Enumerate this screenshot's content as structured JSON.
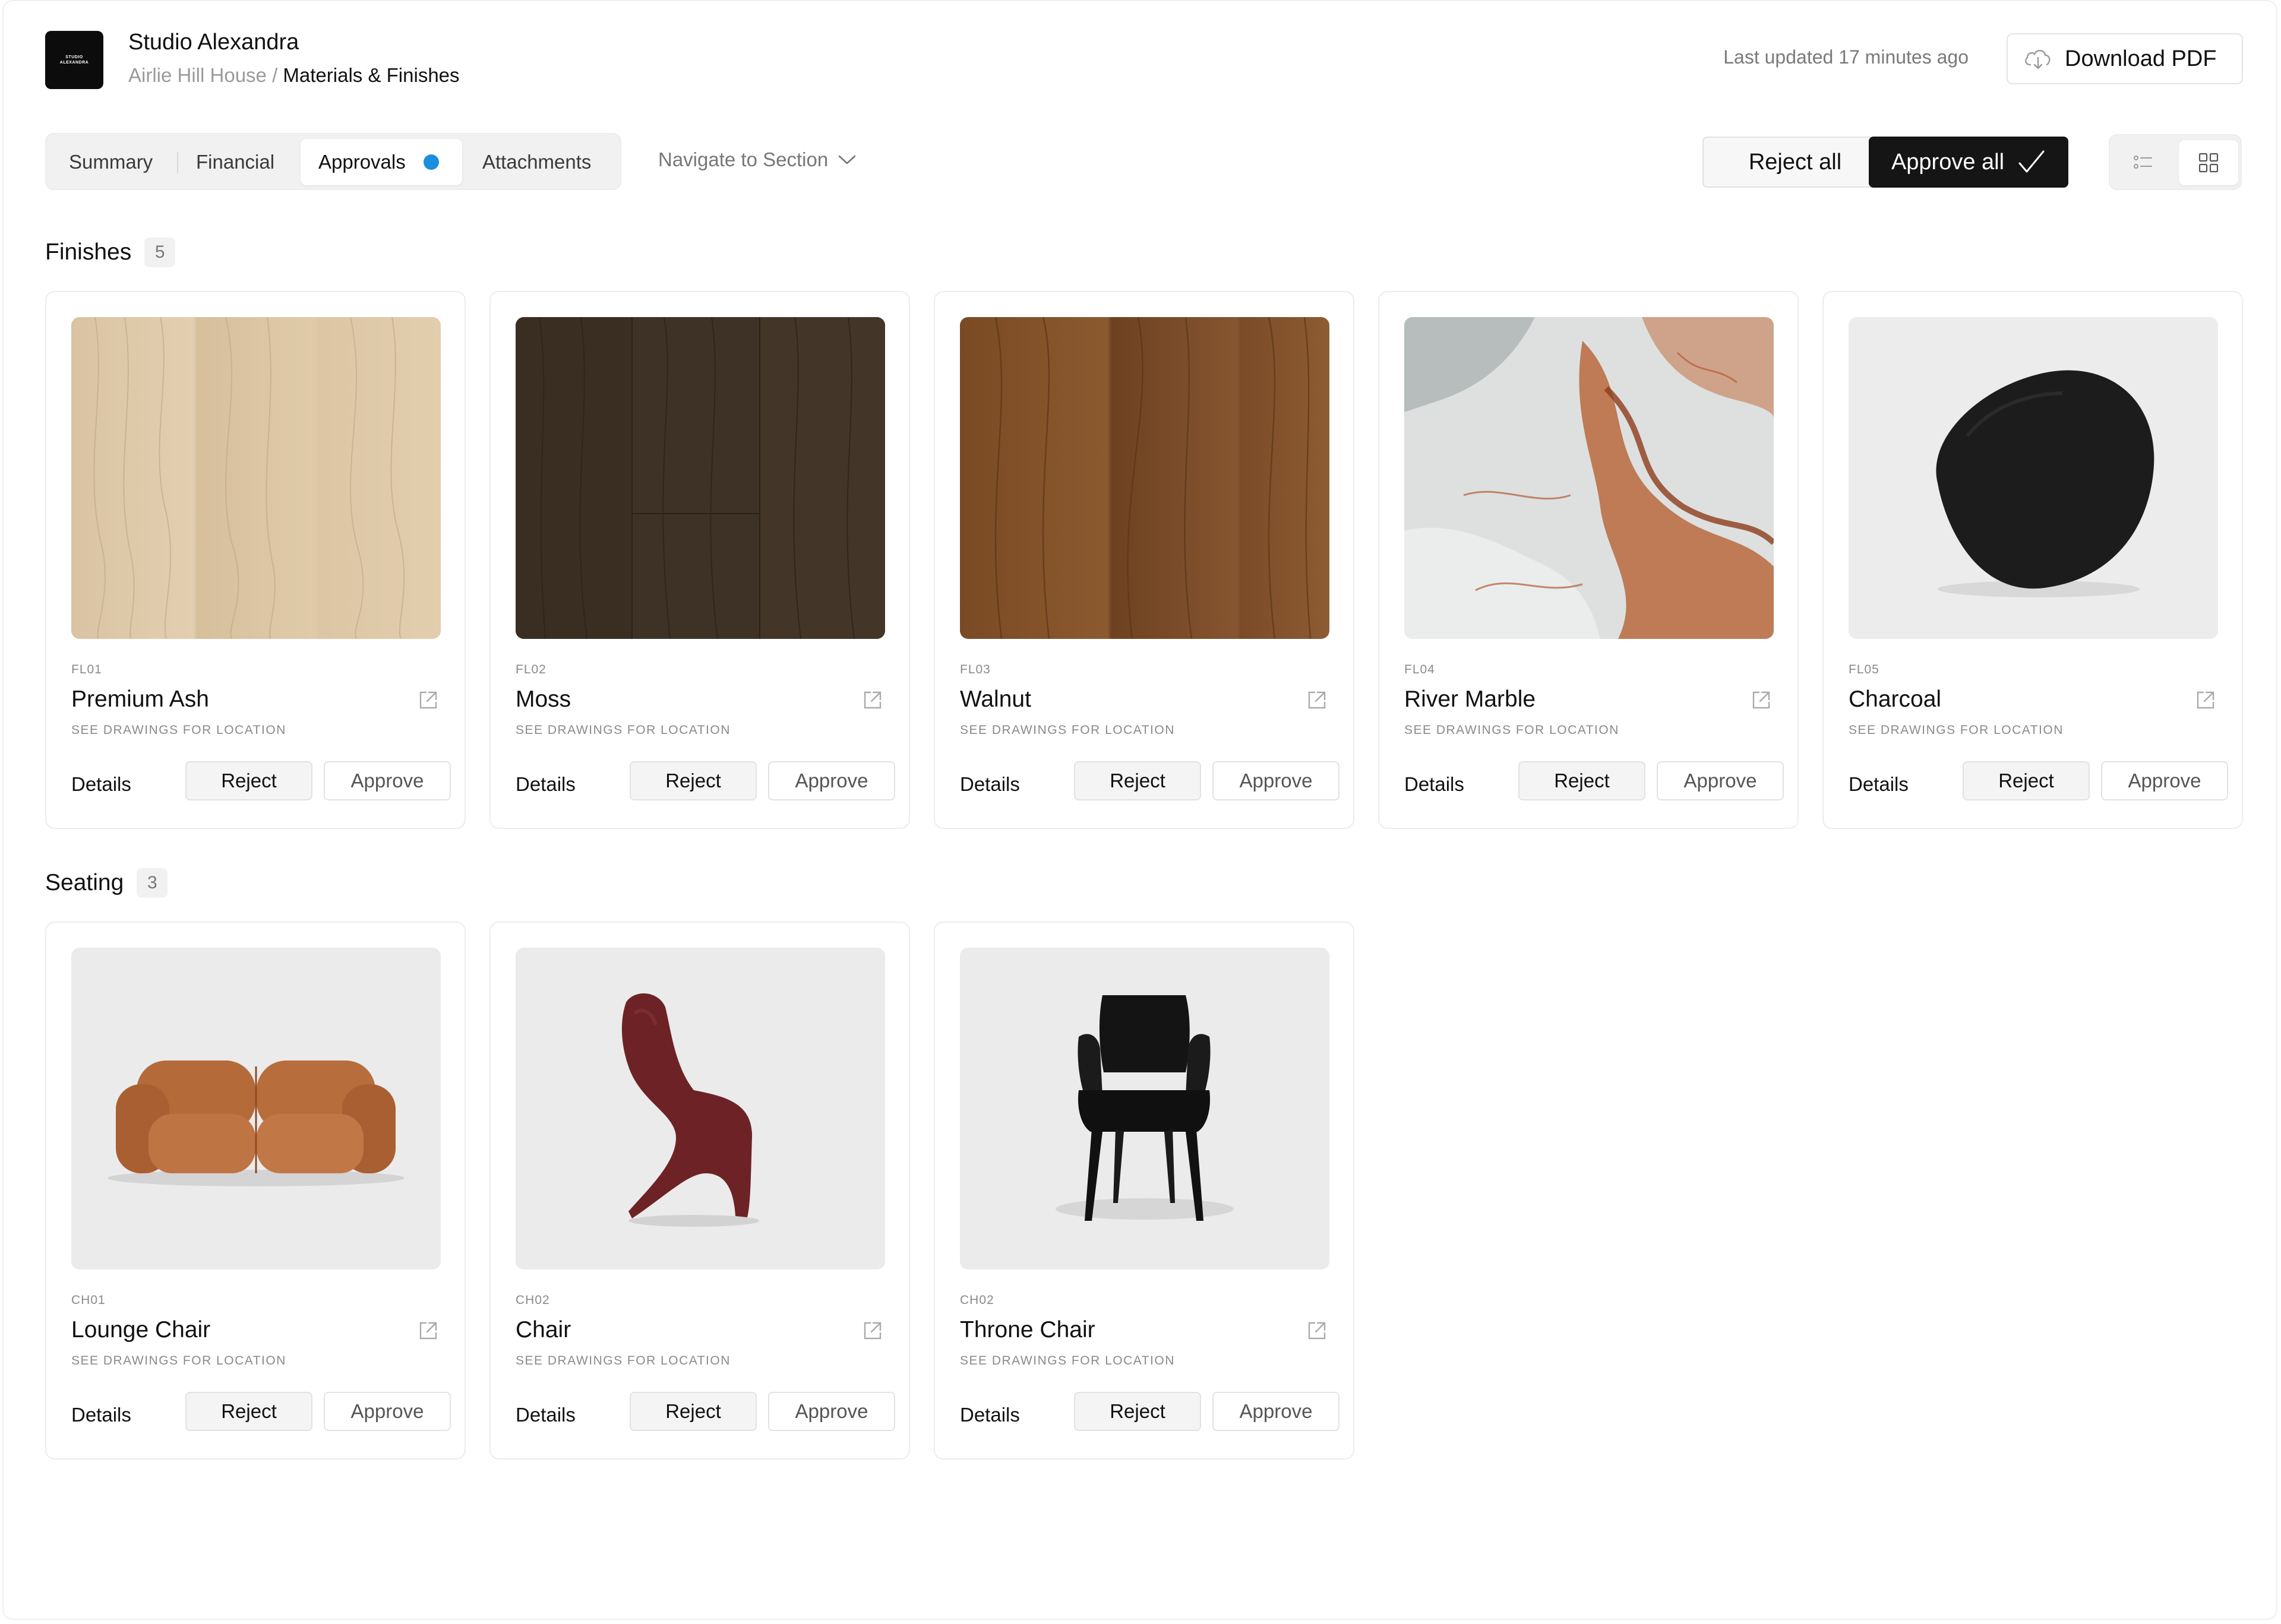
{
  "header": {
    "logo_text": "STUDIO ALEXANDRA",
    "studio_name": "Studio Alexandra",
    "breadcrumb_project": "Airlie Hill House",
    "breadcrumb_separator": " / ",
    "breadcrumb_page": "Materials & Finishes",
    "last_updated": "Last updated 17 minutes ago",
    "download_label": "Download PDF"
  },
  "tabs": [
    {
      "label": "Summary",
      "active": false
    },
    {
      "label": "Financial",
      "active": false
    },
    {
      "label": "Approvals",
      "active": true,
      "badge_color": "#1b8ee0"
    },
    {
      "label": "Attachments",
      "active": false
    }
  ],
  "navigate_label": "Navigate to Section",
  "actions": {
    "reject_all": "Reject all",
    "approve_all": "Approve all"
  },
  "view_mode": "grid",
  "card_buttons": {
    "details": "Details",
    "reject": "Reject",
    "approve": "Approve"
  },
  "sections": [
    {
      "title": "Finishes",
      "count": "5",
      "items": [
        {
          "code": "FL01",
          "name": "Premium Ash",
          "location": "SEE DRAWINGS FOR LOCATION",
          "image": "light-ash-wood-texture"
        },
        {
          "code": "FL02",
          "name": "Moss",
          "location": "SEE DRAWINGS FOR LOCATION",
          "image": "dark-oak-wood-texture"
        },
        {
          "code": "FL03",
          "name": "Walnut",
          "location": "SEE DRAWINGS FOR LOCATION",
          "image": "walnut-wood-texture"
        },
        {
          "code": "FL04",
          "name": "River Marble",
          "location": "SEE DRAWINGS FOR LOCATION",
          "image": "red-veined-marble"
        },
        {
          "code": "FL05",
          "name": "Charcoal",
          "location": "SEE DRAWINGS FOR LOCATION",
          "image": "charcoal-paint-swatch"
        }
      ]
    },
    {
      "title": "Seating",
      "count": "3",
      "items": [
        {
          "code": "CH01",
          "name": "Lounge Chair",
          "location": "SEE DRAWINGS FOR LOCATION",
          "image": "tan-leather-sofa"
        },
        {
          "code": "CH02",
          "name": "Chair",
          "location": "SEE DRAWINGS FOR LOCATION",
          "image": "burgundy-cantilever-chair"
        },
        {
          "code": "CH02",
          "name": "Throne Chair",
          "location": "SEE DRAWINGS FOR LOCATION",
          "image": "black-armchair"
        }
      ]
    }
  ]
}
